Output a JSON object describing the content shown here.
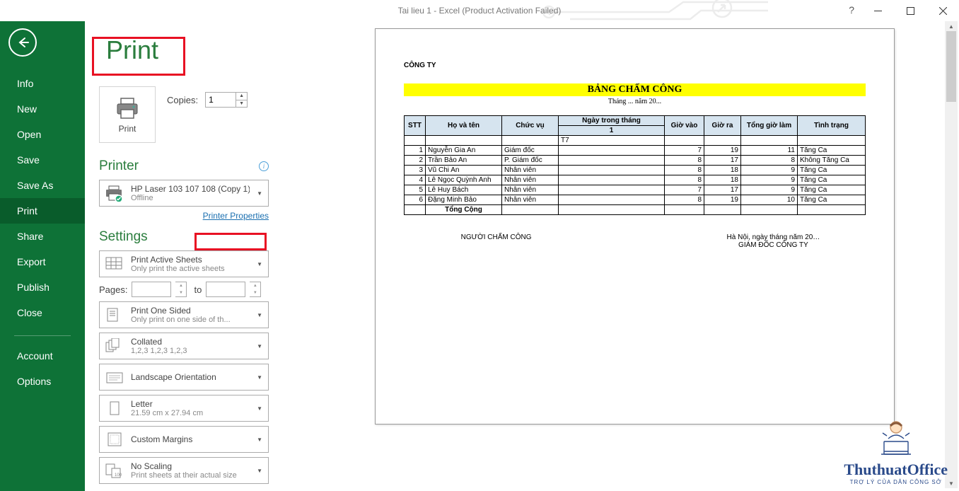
{
  "window": {
    "title": "Tai lieu 1 - Excel (Product Activation Failed)"
  },
  "sidebar": {
    "items": [
      "Info",
      "New",
      "Open",
      "Save",
      "Save As",
      "Print",
      "Share",
      "Export",
      "Publish",
      "Close"
    ],
    "footer": [
      "Account",
      "Options"
    ],
    "active": 5
  },
  "print": {
    "heading": "Print",
    "button_label": "Print",
    "copies_label": "Copies:",
    "copies_value": "1"
  },
  "printer": {
    "section_label": "Printer",
    "name": "HP Laser 103 107 108 (Copy 1)",
    "status": "Offline",
    "properties_link": "Printer Properties"
  },
  "settings": {
    "section_label": "Settings",
    "pages_label": "Pages:",
    "pages_to": "to",
    "items": [
      {
        "primary": "Print Active Sheets",
        "secondary": "Only print the active sheets"
      },
      {
        "primary": "Print One Sided",
        "secondary": "Only print on one side of th..."
      },
      {
        "primary": "Collated",
        "secondary": "1,2,3    1,2,3    1,2,3"
      },
      {
        "primary": "Landscape Orientation",
        "secondary": ""
      },
      {
        "primary": "Letter",
        "secondary": "21.59 cm x 27.94 cm"
      },
      {
        "primary": "Custom Margins",
        "secondary": ""
      },
      {
        "primary": "No Scaling",
        "secondary": "Print sheets at their actual size"
      }
    ]
  },
  "doc": {
    "company": "CÔNG TY",
    "title": "BẢNG CHẤM CÔNG",
    "subtitle": "Tháng ... năm 20...",
    "headers": {
      "stt": "STT",
      "name": "Họ và tên",
      "role": "Chức vụ",
      "day_month": "Ngày trong tháng",
      "day_num": "1",
      "in": "Giờ vào",
      "out": "Giờ ra",
      "total": "Tổng giờ làm",
      "status": "Tình trạng"
    },
    "weekday_row": "T7",
    "rows": [
      {
        "stt": "1",
        "name": "Nguyễn Gia An",
        "role": "Giám đốc",
        "in": "7",
        "out": "19",
        "total": "11",
        "status": "Tăng Ca"
      },
      {
        "stt": "2",
        "name": "Trần Bảo An",
        "role": "P. Giám đốc",
        "in": "8",
        "out": "17",
        "total": "8",
        "status": "Không Tăng Ca"
      },
      {
        "stt": "3",
        "name": "Vũ Chi An",
        "role": "Nhân viên",
        "in": "8",
        "out": "18",
        "total": "9",
        "status": "Tăng Ca"
      },
      {
        "stt": "4",
        "name": "Lê Ngọc Quỳnh Anh",
        "role": "Nhân viên",
        "in": "8",
        "out": "18",
        "total": "9",
        "status": "Tăng Ca"
      },
      {
        "stt": "5",
        "name": "Lê Huy Bách",
        "role": "Nhân viên",
        "in": "7",
        "out": "17",
        "total": "9",
        "status": "Tăng Ca"
      },
      {
        "stt": "6",
        "name": "Đặng Minh Bảo",
        "role": "Nhân viên",
        "in": "8",
        "out": "19",
        "total": "10",
        "status": "Tăng Ca"
      }
    ],
    "total_label": "Tổng Cộng",
    "footer": {
      "left": "NGƯỜI CHẤM CÔNG",
      "right_date": "Hà Nội, ngày        tháng        năm 20…",
      "right_title": "GIÁM ĐỐC CÔNG TY"
    }
  },
  "watermark": {
    "big": "ThuthuatOffice",
    "small": "TRỢ LÝ CỦA DÂN CÔNG SỞ"
  }
}
